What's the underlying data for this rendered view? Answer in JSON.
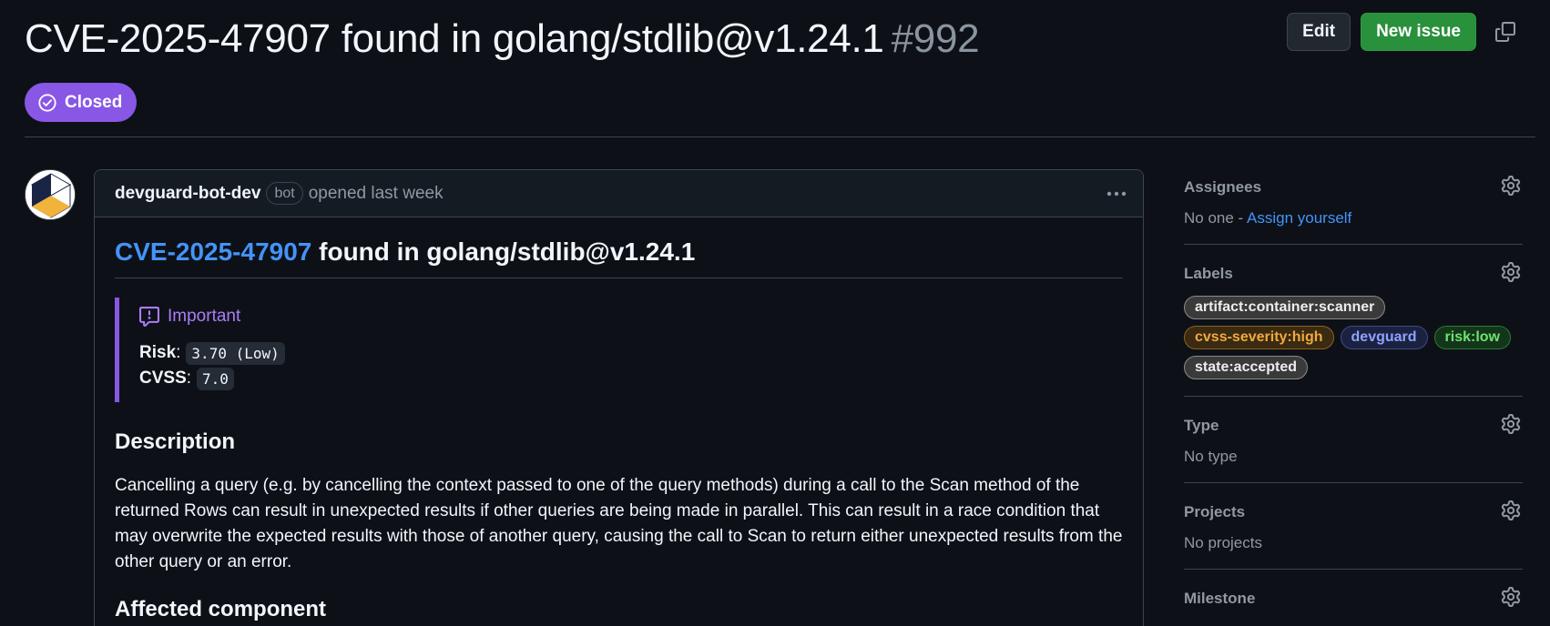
{
  "issue": {
    "title": "CVE-2025-47907 found in golang/stdlib@v1.24.1",
    "number": "#992",
    "state": "Closed"
  },
  "actions": {
    "edit_label": "Edit",
    "new_issue_label": "New issue"
  },
  "comment": {
    "author": "devguard-bot-dev",
    "author_badge": "bot",
    "opened_text": "opened last week",
    "heading_link": "CVE-2025-47907",
    "heading_rest": " found in golang/stdlib@v1.24.1",
    "callout": {
      "title": "Important",
      "risk_label": "Risk",
      "risk_value": "3.70 (Low)",
      "cvss_label": "CVSS",
      "cvss_value": "7.0"
    },
    "description_heading": "Description",
    "description": "Cancelling a query (e.g. by cancelling the context passed to one of the query methods) during a call to the Scan method of the returned Rows can result in unexpected results if other queries are being made in parallel. This can result in a race condition that may overwrite the expected results with those of another query, causing the call to Scan to return either unexpected results from the other query or an error.",
    "next_heading": "Affected component"
  },
  "sidebar": {
    "assignees": {
      "title": "Assignees",
      "value": "No one - ",
      "link": "Assign yourself"
    },
    "labels": {
      "title": "Labels",
      "items": [
        {
          "name": "artifact:container:scanner",
          "color": "#ededed",
          "bg": "#3a3a3a",
          "border": "#8a8a8a"
        },
        {
          "name": "cvss-severity:high",
          "color": "#f0a93b",
          "bg": "#3b2a12",
          "border": "#8c6121"
        },
        {
          "name": "devguard",
          "color": "#8fa3ff",
          "bg": "#1b2140",
          "border": "#3d4a8a"
        },
        {
          "name": "risk:low",
          "color": "#6fe26f",
          "bg": "#13361a",
          "border": "#2b7a35"
        },
        {
          "name": "state:accepted",
          "color": "#ededed",
          "bg": "#3a3a3a",
          "border": "#8a8a8a"
        }
      ]
    },
    "type": {
      "title": "Type",
      "value": "No type"
    },
    "projects": {
      "title": "Projects",
      "value": "No projects"
    },
    "milestone": {
      "title": "Milestone"
    }
  },
  "icons": {
    "state": "check-circle-icon",
    "copy": "copy-icon",
    "kebab": "kebab-horizontal-icon",
    "callout": "report-icon",
    "gear": "gear-icon"
  }
}
